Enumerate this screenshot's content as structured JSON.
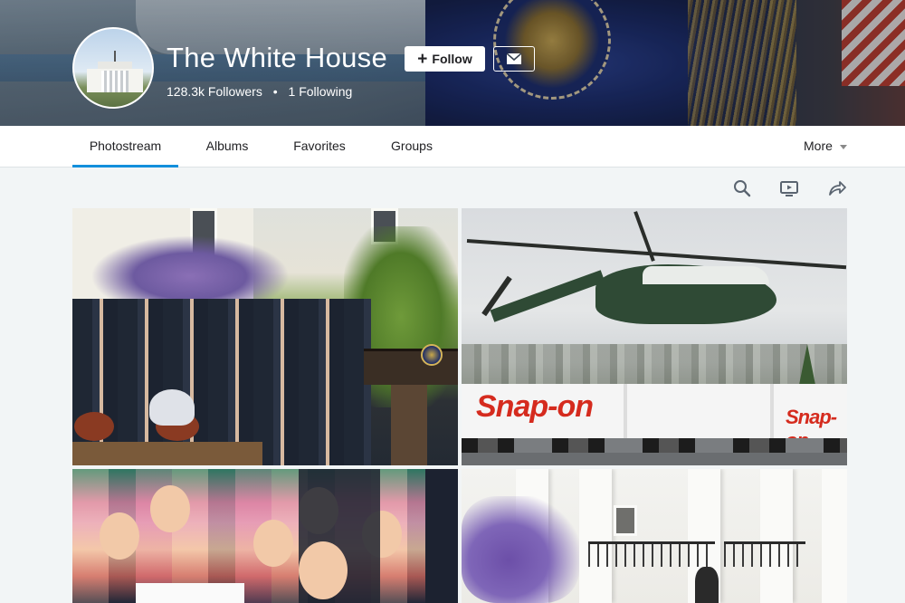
{
  "profile": {
    "name": "The White House",
    "followers": "128.3k Followers",
    "separator": "•",
    "following": "1 Following",
    "follow_label": "Follow",
    "follow_icon": "plus-icon",
    "message_icon": "envelope-icon"
  },
  "tabs": [
    {
      "label": "Photostream",
      "active": true
    },
    {
      "label": "Albums",
      "active": false
    },
    {
      "label": "Favorites",
      "active": false
    },
    {
      "label": "Groups",
      "active": false
    }
  ],
  "more_label": "More",
  "toolbar": {
    "icons": [
      "search-icon",
      "slideshow-icon",
      "share-icon"
    ]
  },
  "photos": [
    {
      "brand_text": ""
    },
    {
      "brand_text": "Snap-on",
      "brand_text_2": "Snap-on"
    },
    {
      "brand_text": ""
    },
    {
      "brand_text": ""
    }
  ],
  "colors": {
    "accent": "#128fdc",
    "nav_text": "#212124",
    "page_bg": "#f2f5f6",
    "brand_red": "#d52b1e"
  }
}
